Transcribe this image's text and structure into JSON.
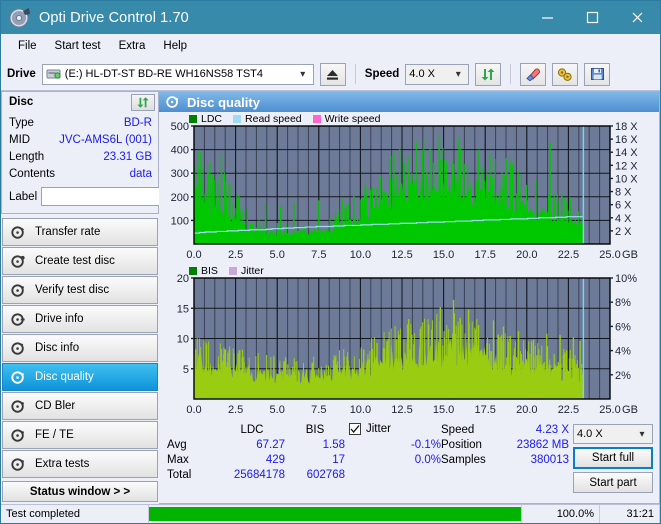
{
  "window": {
    "title": "Opti Drive Control 1.70",
    "icon": "disc-icon",
    "minimize": "–",
    "maximize": "□",
    "close": "✕"
  },
  "menu": {
    "items": [
      "File",
      "Start test",
      "Extra",
      "Help"
    ]
  },
  "toolbar": {
    "drive_label": "Drive",
    "drive_value": "(E:)  HL-DT-ST BD-RE  WH16NS58 TST4",
    "eject_icon": "eject-icon",
    "speed_label": "Speed",
    "speed_value": "4.0 X",
    "refresh_icon": "refresh-icon",
    "erase_icon": "eraser-icon",
    "tools_icon": "tools-icon",
    "save_icon": "save-icon"
  },
  "disc": {
    "panel_title": "Disc",
    "refresh_icon": "refresh-icon",
    "rows": [
      {
        "key": "Type",
        "value": "BD-R"
      },
      {
        "key": "MID",
        "value": "JVC-AMS6L (001)"
      },
      {
        "key": "Length",
        "value": "23.31 GB"
      },
      {
        "key": "Contents",
        "value": "data"
      }
    ],
    "label_key": "Label",
    "label_value": "",
    "label_placeholder": "",
    "disc_icon": "disc-icon"
  },
  "nav": {
    "items": [
      {
        "label": "Transfer rate",
        "icon": "disc-test-icon",
        "selected": false
      },
      {
        "label": "Create test disc",
        "icon": "disc-burn-icon",
        "selected": false
      },
      {
        "label": "Verify test disc",
        "icon": "disc-check-icon",
        "selected": false
      },
      {
        "label": "Drive info",
        "icon": "drive-info-icon",
        "selected": false
      },
      {
        "label": "Disc info",
        "icon": "disc-info-icon",
        "selected": false
      },
      {
        "label": "Disc quality",
        "icon": "disc-quality-icon",
        "selected": true
      },
      {
        "label": "CD Bler",
        "icon": "disc-bler-icon",
        "selected": false
      },
      {
        "label": "FE / TE",
        "icon": "disc-fete-icon",
        "selected": false
      },
      {
        "label": "Extra tests",
        "icon": "disc-extra-icon",
        "selected": false
      }
    ],
    "status_window": "Status window > >"
  },
  "main": {
    "header_title": "Disc quality",
    "header_icon": "disc-quality-icon"
  },
  "colors": {
    "accent": "#378aaa",
    "plot_bg": "#6d7b99",
    "grid": "#2a2a33",
    "ldc": "#00c800",
    "bis": "#00c800",
    "jitter": "#c9a8d8",
    "read_speed": "#9fdcf4",
    "write_speed": "#ff66cc",
    "value_text": "#1a1af0",
    "progress": "#00b400"
  },
  "chart_data": [
    {
      "type": "area",
      "name": "ldc-chart",
      "title": "",
      "legend": [
        {
          "label": "LDC",
          "color": "#008000"
        },
        {
          "label": "Read speed",
          "color": "#9fdcf4"
        },
        {
          "label": "Write speed",
          "color": "#ff66cc"
        }
      ],
      "legend_position": "top-left",
      "grid": true,
      "xlabel": "GB",
      "xlim": [
        0,
        25
      ],
      "xticks": [
        "0.0",
        "2.5",
        "5.0",
        "7.5",
        "10.0",
        "12.5",
        "15.0",
        "17.5",
        "20.0",
        "22.5",
        "25.0"
      ],
      "ylabel": "",
      "ylim": [
        0,
        500
      ],
      "yticks": [
        "100",
        "200",
        "300",
        "400",
        "500"
      ],
      "y2label": "X",
      "y2lim": [
        0,
        18
      ],
      "y2ticks": [
        "2 X",
        "4 X",
        "6 X",
        "8 X",
        "10 X",
        "12 X",
        "14 X",
        "16 X",
        "18 X"
      ],
      "data_end_x": 23.4,
      "series": [
        {
          "name": "LDC",
          "color": "#00c800",
          "x": [
            0.0,
            0.3,
            0.6,
            0.9,
            1.2,
            1.5,
            1.8,
            2.1,
            2.4,
            2.7,
            3.0,
            3.3,
            3.6,
            3.9,
            4.2,
            4.5,
            4.8,
            5.1,
            5.4,
            5.7,
            6.0,
            6.3,
            6.6,
            6.9,
            7.2,
            7.5,
            7.8,
            8.1,
            8.4,
            8.7,
            9.0,
            9.3,
            9.6,
            9.9,
            10.2,
            10.5,
            10.8,
            11.1,
            11.4,
            11.7,
            12.0,
            12.3,
            12.6,
            12.9,
            13.2,
            13.5,
            13.8,
            14.1,
            14.4,
            14.7,
            15.0,
            15.3,
            15.6,
            15.9,
            16.2,
            16.5,
            16.8,
            17.1,
            17.4,
            17.7,
            18.0,
            18.3,
            18.6,
            18.9,
            19.2,
            19.5,
            19.8,
            20.1,
            20.4,
            20.7,
            21.0,
            21.3,
            21.6,
            21.9,
            22.2,
            22.5,
            22.8,
            23.1,
            23.4
          ],
          "values": [
            190,
            205,
            185,
            170,
            160,
            155,
            150,
            140,
            120,
            110,
            72,
            60,
            55,
            52,
            50,
            48,
            46,
            45,
            44,
            45,
            44,
            43,
            44,
            45,
            46,
            48,
            52,
            60,
            68,
            75,
            80,
            88,
            95,
            105,
            115,
            128,
            140,
            150,
            165,
            178,
            192,
            200,
            210,
            218,
            226,
            232,
            238,
            240,
            238,
            234,
            230,
            228,
            226,
            222,
            218,
            214,
            210,
            205,
            200,
            196,
            190,
            186,
            182,
            176,
            170,
            163,
            156,
            148,
            140,
            133,
            126,
            118,
            112,
            105,
            100,
            96,
            92,
            88,
            85
          ]
        },
        {
          "name": "Read speed",
          "color": "#9fdcf4",
          "axis": "y2",
          "x": [
            0.0,
            2.0,
            4.0,
            6.0,
            8.0,
            10.0,
            12.0,
            14.0,
            16.0,
            18.0,
            20.0,
            22.0,
            23.4
          ],
          "values": [
            1.7,
            2.0,
            2.2,
            2.5,
            2.7,
            2.9,
            3.1,
            3.3,
            3.5,
            3.7,
            3.9,
            4.1,
            4.2
          ]
        }
      ],
      "peaks": [
        {
          "x": 1.65,
          "y": 380
        },
        {
          "x": 0.35,
          "y": 262
        },
        {
          "x": 2.15,
          "y": 252
        },
        {
          "x": 12.2,
          "y": 295
        },
        {
          "x": 14.4,
          "y": 345
        },
        {
          "x": 15.6,
          "y": 340
        },
        {
          "x": 16.0,
          "y": 330
        },
        {
          "x": 21.4,
          "y": 429
        },
        {
          "x": 13.1,
          "y": 300
        },
        {
          "x": 17.6,
          "y": 300
        },
        {
          "x": 18.7,
          "y": 290
        },
        {
          "x": 11.0,
          "y": 240
        },
        {
          "x": 6.0,
          "y": 180
        },
        {
          "x": 8.9,
          "y": 190
        },
        {
          "x": 4.3,
          "y": 175
        },
        {
          "x": 9.6,
          "y": 205
        },
        {
          "x": 22.1,
          "y": 215
        },
        {
          "x": 22.6,
          "y": 200
        },
        {
          "x": 20.0,
          "y": 185
        },
        {
          "x": 19.4,
          "y": 215
        },
        {
          "x": 10.3,
          "y": 260
        },
        {
          "x": 10.6,
          "y": 230
        },
        {
          "x": 5.2,
          "y": 160
        },
        {
          "x": 7.5,
          "y": 185
        },
        {
          "x": 3.2,
          "y": 150
        },
        {
          "x": 2.7,
          "y": 205
        },
        {
          "x": 1.2,
          "y": 230
        },
        {
          "x": 0.8,
          "y": 215
        }
      ]
    },
    {
      "type": "area",
      "name": "bis-chart",
      "title": "",
      "legend": [
        {
          "label": "BIS",
          "color": "#008000"
        },
        {
          "label": "Jitter",
          "color": "#c9a8d8"
        }
      ],
      "legend_position": "top-left",
      "grid": true,
      "xlabel": "GB",
      "xlim": [
        0,
        25
      ],
      "xticks": [
        "0.0",
        "2.5",
        "5.0",
        "7.5",
        "10.0",
        "12.5",
        "15.0",
        "17.5",
        "20.0",
        "22.5",
        "25.0"
      ],
      "ylabel": "",
      "ylim": [
        0,
        20
      ],
      "yticks": [
        "5",
        "10",
        "15",
        "20"
      ],
      "y2label": "%",
      "y2lim": [
        0,
        10
      ],
      "y2ticks": [
        "2%",
        "4%",
        "6%",
        "8%",
        "10%"
      ],
      "data_end_x": 23.4,
      "series": [
        {
          "name": "BIS",
          "color": "#9acd12",
          "x": [
            0.0,
            0.5,
            1.0,
            1.5,
            2.0,
            2.5,
            3.0,
            3.5,
            4.0,
            4.5,
            5.0,
            5.5,
            6.0,
            6.5,
            7.0,
            7.5,
            8.0,
            8.5,
            9.0,
            9.5,
            10.0,
            10.5,
            11.0,
            11.5,
            12.0,
            12.5,
            13.0,
            13.5,
            14.0,
            14.5,
            15.0,
            15.5,
            16.0,
            16.5,
            17.0,
            17.5,
            18.0,
            18.5,
            19.0,
            19.5,
            20.0,
            20.5,
            21.0,
            21.5,
            22.0,
            22.5,
            23.0,
            23.4
          ],
          "values": [
            6.2,
            5.5,
            5.1,
            4.9,
            4.9,
            4.6,
            4.3,
            4.1,
            4.0,
            3.9,
            3.8,
            3.7,
            3.6,
            3.6,
            3.7,
            3.8,
            4.0,
            4.2,
            4.4,
            4.5,
            4.7,
            5.2,
            5.6,
            6.0,
            6.3,
            6.6,
            6.8,
            7.1,
            7.4,
            7.8,
            7.6,
            7.5,
            7.4,
            7.2,
            7.0,
            6.6,
            6.3,
            6.0,
            5.7,
            5.4,
            5.2,
            5.0,
            4.8,
            4.6,
            4.5,
            4.3,
            4.2,
            4.1
          ]
        },
        {
          "name": "Jitter",
          "color": "#c9a8d8",
          "axis": "y2",
          "x": [],
          "values": []
        }
      ],
      "peaks": [
        {
          "x": 0.1,
          "y": 8.2
        },
        {
          "x": 0.35,
          "y": 7.6
        },
        {
          "x": 2.9,
          "y": 6.8
        },
        {
          "x": 9.2,
          "y": 7.0
        },
        {
          "x": 11.0,
          "y": 9.2
        },
        {
          "x": 11.6,
          "y": 9.5
        },
        {
          "x": 12.3,
          "y": 10.3
        },
        {
          "x": 12.9,
          "y": 13.2
        },
        {
          "x": 14.1,
          "y": 12.3
        },
        {
          "x": 14.8,
          "y": 15.2
        },
        {
          "x": 15.6,
          "y": 16.4
        },
        {
          "x": 16.5,
          "y": 14.8
        },
        {
          "x": 17.1,
          "y": 12.2
        },
        {
          "x": 18.0,
          "y": 13.0
        },
        {
          "x": 18.6,
          "y": 12.0
        },
        {
          "x": 19.5,
          "y": 11.2
        },
        {
          "x": 20.4,
          "y": 9.8
        },
        {
          "x": 21.2,
          "y": 10.8
        },
        {
          "x": 22.0,
          "y": 10.6
        },
        {
          "x": 22.8,
          "y": 10.2
        },
        {
          "x": 5.4,
          "y": 6.2
        },
        {
          "x": 7.1,
          "y": 6.0
        },
        {
          "x": 8.4,
          "y": 6.4
        },
        {
          "x": 10.2,
          "y": 8.2
        },
        {
          "x": 13.6,
          "y": 11.6
        },
        {
          "x": 16.0,
          "y": 13.4
        },
        {
          "x": 19.0,
          "y": 10.4
        },
        {
          "x": 23.2,
          "y": 9.6
        }
      ]
    }
  ],
  "stats": {
    "col_headers": [
      "LDC",
      "BIS"
    ],
    "rows": [
      {
        "label": "Avg",
        "ldc": "67.27",
        "bis": "1.58",
        "jitter": "-0.1%"
      },
      {
        "label": "Max",
        "ldc": "429",
        "bis": "17",
        "jitter": "0.0%"
      },
      {
        "label": "Total",
        "ldc": "25684178",
        "bis": "602768",
        "jitter": ""
      }
    ],
    "jitter_label": "Jitter",
    "jitter_checked": true,
    "info": [
      {
        "key": "Speed",
        "value": "4.23 X"
      },
      {
        "key": "Position",
        "value": "23862 MB"
      },
      {
        "key": "Samples",
        "value": "380013"
      }
    ],
    "speed_select": "4.0 X",
    "start_full": "Start full",
    "start_part": "Start part"
  },
  "statusbar": {
    "text": "Test completed",
    "percent": "100.0%",
    "progress": 100,
    "time": "31:21"
  }
}
